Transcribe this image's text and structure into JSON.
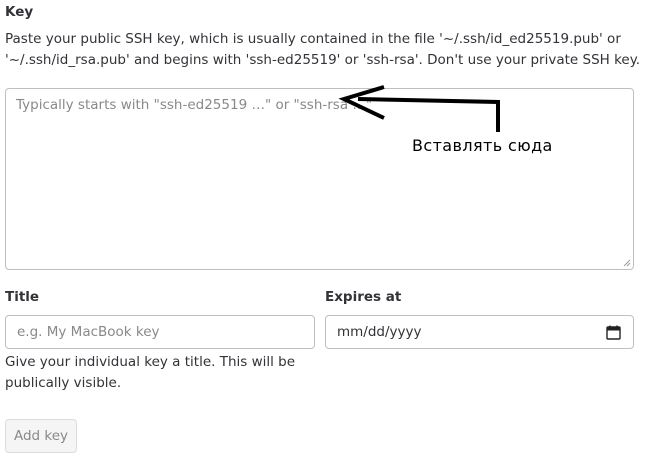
{
  "key_section": {
    "label": "Key",
    "help_line1": "Paste your public SSH key, which is usually contained in the file '~/.ssh/id_ed25519.pub' or",
    "help_line2": "'~/.ssh/id_rsa.pub' and begins with 'ssh-ed25519' or 'ssh-rsa'. Don't use your private SSH key.",
    "textarea_placeholder": "Typically starts with \"ssh-ed25519 …\" or \"ssh-rsa …\""
  },
  "annotation": {
    "text": "Вставлять сюда",
    "arrow_color": "#000000"
  },
  "title_field": {
    "label": "Title",
    "placeholder": "e.g. My MacBook key",
    "help_line1": "Give your individual key a title. This will be",
    "help_line2": "publically visible."
  },
  "expires_field": {
    "label": "Expires at",
    "value": "mm/dd/yyyy",
    "icon": "calendar-icon"
  },
  "actions": {
    "add_key_label": "Add key"
  },
  "colors": {
    "text": "#333238",
    "placeholder": "#89888d",
    "border": "#bfbfc3",
    "button_bg": "#f5f5f5"
  }
}
